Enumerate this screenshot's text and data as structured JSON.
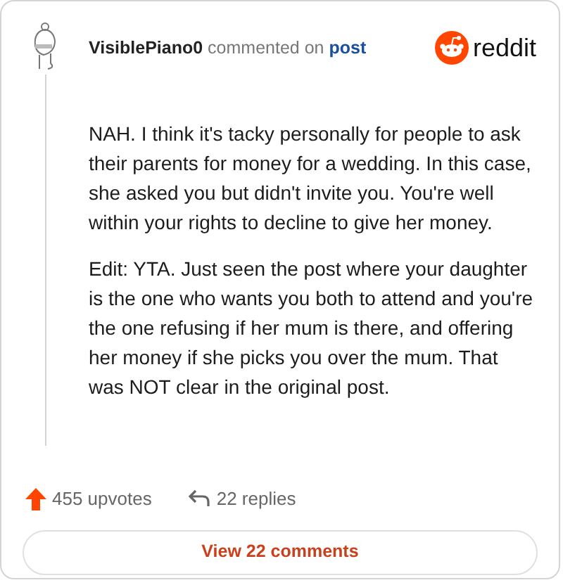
{
  "header": {
    "username": "VisiblePiano0",
    "action": "commented on",
    "link": "post",
    "brand": "reddit"
  },
  "comment": {
    "paragraphs": [
      "NAH. I think it's tacky personally for people to ask their parents for money for a wedding. In this case, she asked you but didn't invite you. You're well within your rights to decline to give her money.",
      "Edit: YTA. Just seen the post where your daughter is the one who wants you both to attend and you're the one refusing if her mum is there, and offering her money if she picks you over the mum. That was NOT clear in the original post."
    ]
  },
  "stats": {
    "upvotes": "455 upvotes",
    "replies": "22 replies"
  },
  "view_button": "View 22 comments"
}
